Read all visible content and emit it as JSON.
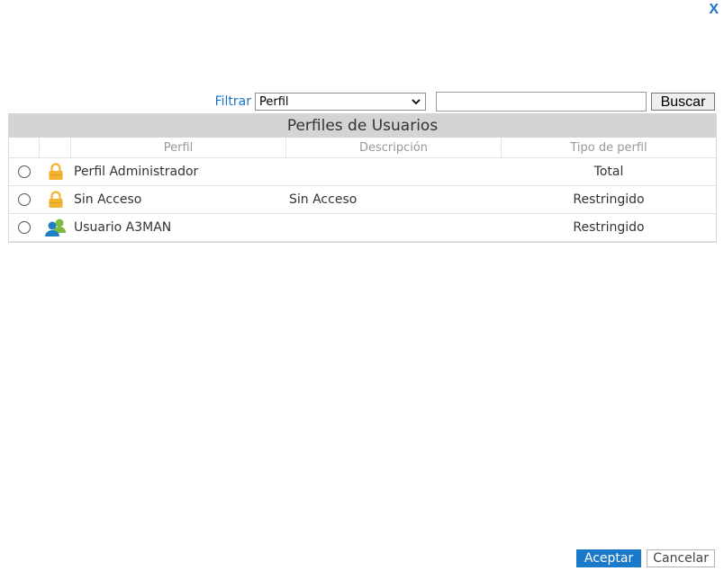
{
  "window": {
    "close_label": "X"
  },
  "filter": {
    "label": "Filtrar",
    "select_value": "Perfil",
    "search_value": "",
    "search_button": "Buscar"
  },
  "grid": {
    "title": "Perfiles de Usuarios",
    "columns": [
      "Perfil",
      "Descripción",
      "Tipo de perfil"
    ],
    "rows": [
      {
        "icon": "lock-icon",
        "perfil": "Perfil Administrador",
        "descripcion": "",
        "tipo": "Total"
      },
      {
        "icon": "lock-icon",
        "perfil": "Sin Acceso",
        "descripcion": "Sin Acceso",
        "tipo": "Restringido"
      },
      {
        "icon": "user-group-icon",
        "perfil": "Usuario A3MAN",
        "descripcion": "",
        "tipo": "Restringido"
      }
    ]
  },
  "actions": {
    "accept": "Aceptar",
    "cancel": "Cancelar"
  },
  "colors": {
    "accent": "#1a7ac9",
    "lock": "#f2b330",
    "user_blue": "#1f7fc4",
    "user_green": "#7dbb3f"
  }
}
